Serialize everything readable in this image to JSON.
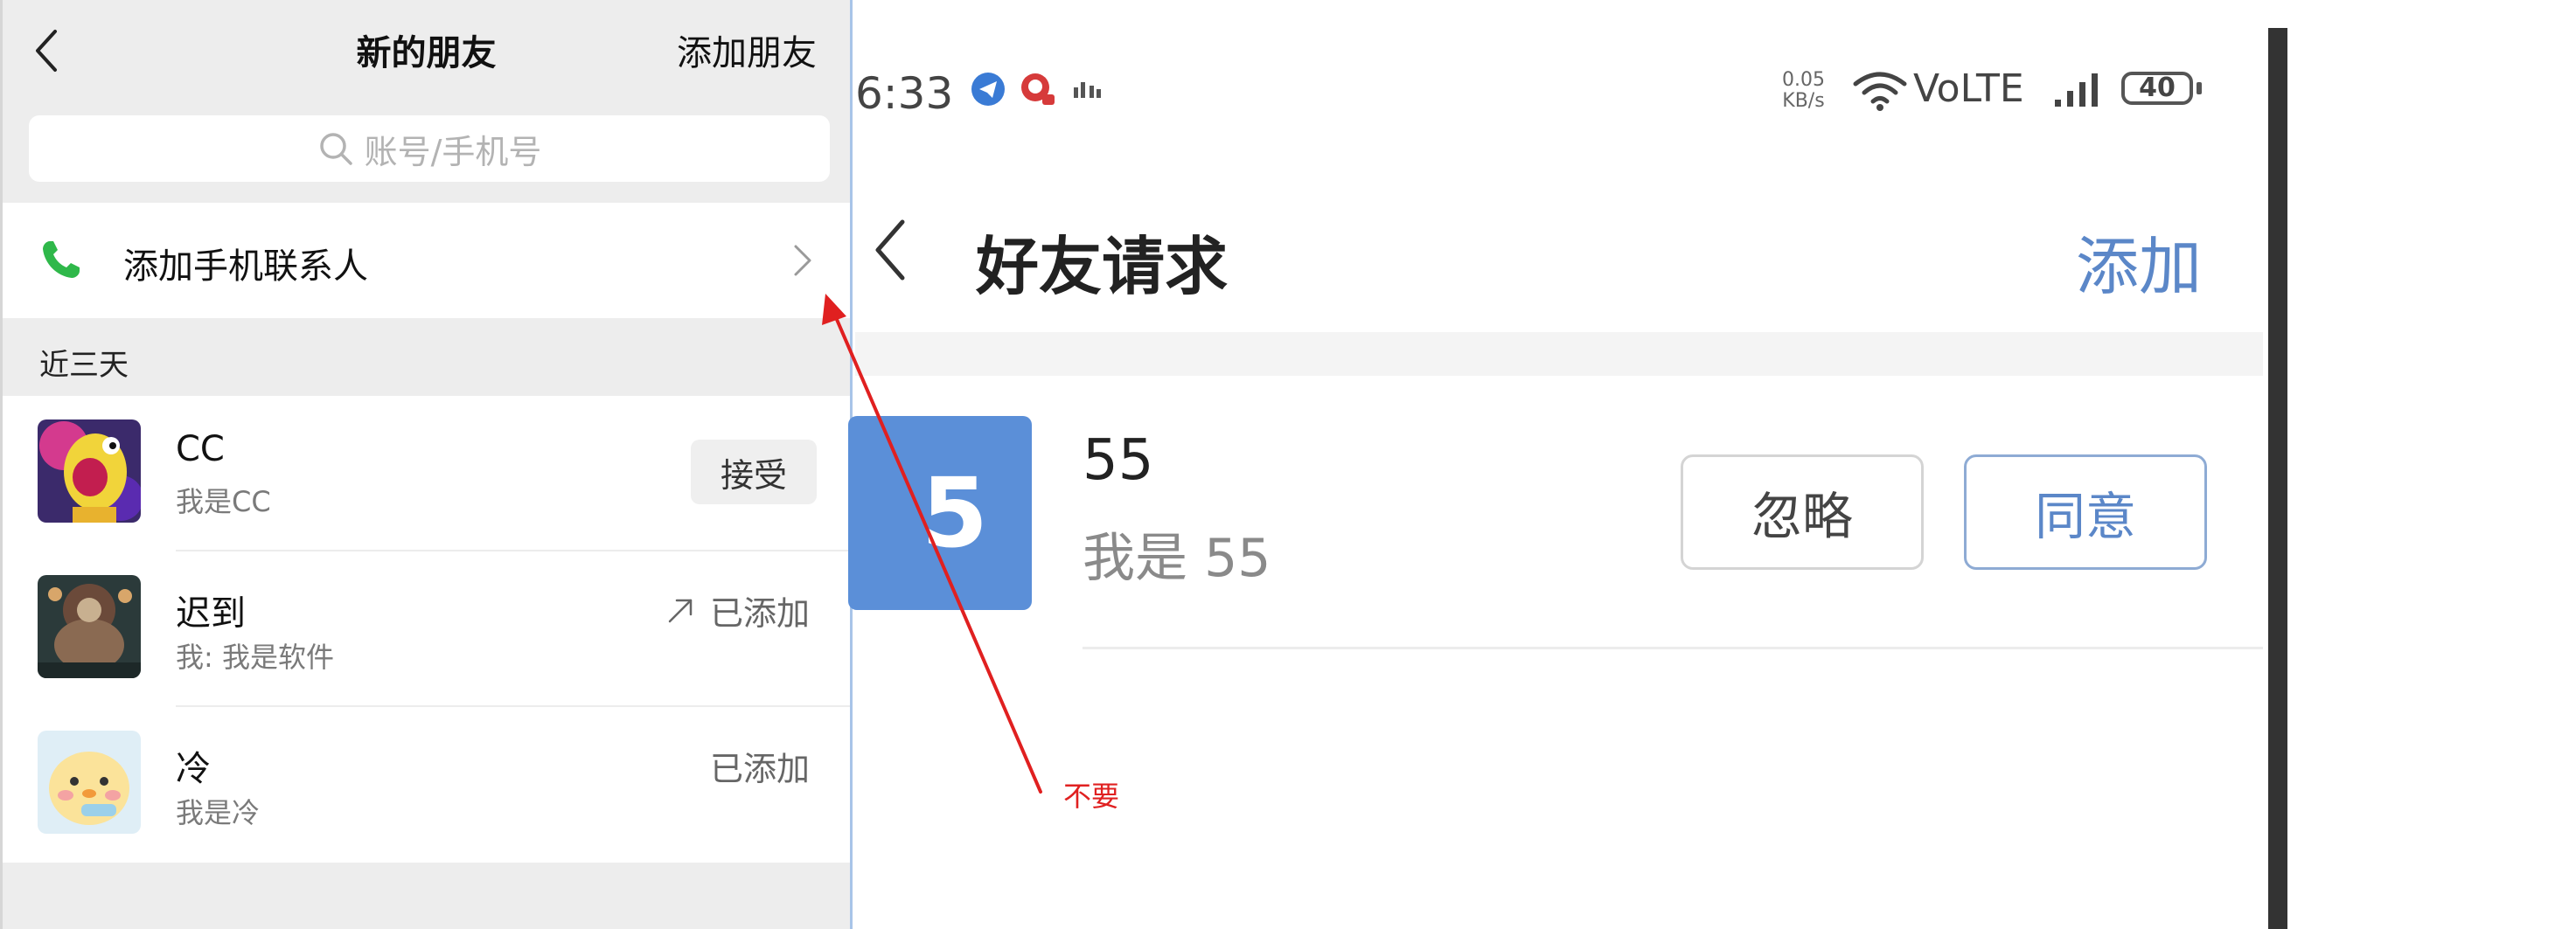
{
  "left": {
    "nav": {
      "title": "新的朋友",
      "add_label": "添加朋友"
    },
    "search": {
      "placeholder": "账号/手机号"
    },
    "contacts_row": {
      "label": "添加手机联系人"
    },
    "section": "近三天",
    "items": [
      {
        "name": "CC",
        "message": "我是CC",
        "action": "接受"
      },
      {
        "name": "迟到",
        "message": "我: 我是软件",
        "status": "已添加"
      },
      {
        "name": "冷",
        "message": "我是冷",
        "status": "已添加"
      }
    ]
  },
  "right": {
    "status_bar": {
      "time": "6:33",
      "net_speed_top": "0.05",
      "net_speed_bottom": "KB/s",
      "volte": "VoLTE",
      "battery": "40"
    },
    "nav": {
      "title": "好友请求",
      "add_label": "添加"
    },
    "request": {
      "avatar_text": "5",
      "name": "55",
      "message": "我是 55",
      "ignore_label": "忽略",
      "agree_label": "同意"
    }
  },
  "annotation": {
    "text": "不要",
    "color": "#e02020"
  },
  "colors": {
    "accent_blue": "#5b87c8",
    "avatar_blue": "#5b8fd8",
    "phone_green": "#2fb84a",
    "panel_bg": "#ededed"
  }
}
